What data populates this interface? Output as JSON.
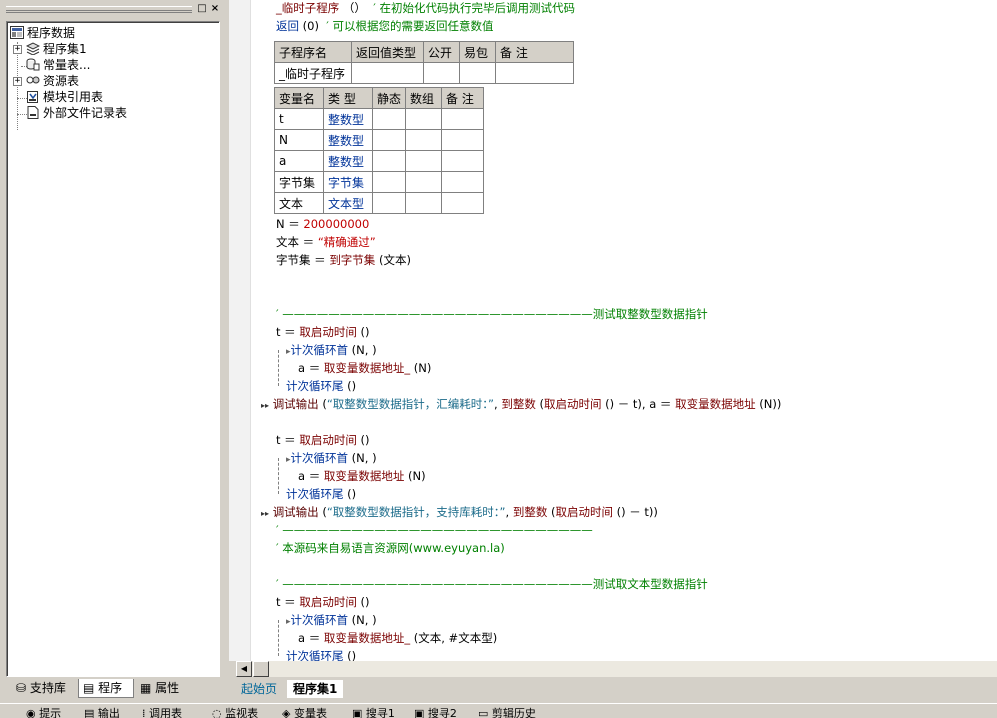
{
  "left_panel": {
    "close_glyph": "×",
    "restore_glyph": "□",
    "tree": [
      {
        "label": "程序数据",
        "icon": "program-data-icon"
      },
      {
        "label": "程序集1",
        "icon": "assembly-icon"
      },
      {
        "label": "常量表...",
        "icon": "constant-table-icon"
      },
      {
        "label": "资源表",
        "icon": "resource-table-icon"
      },
      {
        "label": "模块引用表",
        "icon": "module-ref-icon"
      },
      {
        "label": "外部文件记录表",
        "icon": "external-file-icon"
      }
    ],
    "tabs": [
      "支持库",
      "程序",
      "属性"
    ]
  },
  "code": {
    "sub_line": {
      "name": "_临时子程序",
      "parens": " （）",
      "comment": "′ 在初始化代码执行完毕后调用测试代码"
    },
    "return_line": {
      "kw": "返回",
      "arg": " (0)",
      "comment": "′ 可以根据您的需要返回任意数值"
    },
    "sub_table": {
      "headers": [
        "子程序名",
        "返回值类型",
        "公开",
        "易包",
        "备 注"
      ],
      "row": [
        "_临时子程序",
        "",
        "",
        "",
        ""
      ]
    },
    "var_table": {
      "headers": [
        "变量名",
        "类 型",
        "静态",
        "数组",
        "备 注"
      ],
      "rows": [
        [
          "t",
          "整数型",
          "",
          "",
          ""
        ],
        [
          "N",
          "整数型",
          "",
          "",
          ""
        ],
        [
          "a",
          "整数型",
          "",
          "",
          ""
        ],
        [
          "字节集",
          "字节集",
          "",
          "",
          ""
        ],
        [
          "文本",
          "文本型",
          "",
          "",
          ""
        ]
      ]
    },
    "assign1": {
      "lhs": "N ＝ ",
      "rhs": "200000000"
    },
    "assign2": {
      "lhs": "文本 ＝ ",
      "rhs": "“精确通过”"
    },
    "assign3": {
      "lhs": "字节集 ＝ ",
      "fn": "到字节集",
      "arg": " (文本)"
    },
    "sep1": "′ ———————————————————————————测试取整数型数据指针",
    "block1": {
      "t_assign": "t ＝ ",
      "t_fn": "取启动时间",
      "t_tail": " ()",
      "loop_head": "计次循环首",
      "loop_args": " (N, )",
      "body_lhs": "a ＝ ",
      "body_fn": "取变量数据地址_",
      "body_args": " (N)",
      "loop_tail": "计次循环尾",
      "loop_tail_args": " ()"
    },
    "debug1": {
      "fn": "调试输出",
      "p1": " (",
      "str": "“取整数型数据指针，汇编耗时：”",
      "p2": ", ",
      "fn2": "到整数",
      "p3": " (",
      "fn3": "取启动时间",
      "p4": " () － t), a ＝ ",
      "fn4": "取变量数据地址",
      "p5": " (N))"
    },
    "block2": {
      "t_assign": "t ＝ ",
      "t_fn": "取启动时间",
      "t_tail": " ()",
      "loop_head": "计次循环首",
      "loop_args": " (N, )",
      "body_lhs": "a ＝ ",
      "body_fn": "取变量数据地址",
      "body_args": " (N)",
      "loop_tail": "计次循环尾",
      "loop_tail_args": " ()"
    },
    "debug2": {
      "fn": "调试输出",
      "p1": " (",
      "str": "“取整数型数据指针，支持库耗时：”",
      "p2": ", ",
      "fn2": "到整数",
      "p3": " (",
      "fn3": "取启动时间",
      "p4": " () － t))"
    },
    "sep2": "′ ———————————————————————————",
    "source_comment": "′ 本源码来自易语言资源网(www.eyuyan.la)",
    "sep3": "′ ———————————————————————————测试取文本型数据指针",
    "block3": {
      "t_assign": "t ＝ ",
      "t_fn": "取启动时间",
      "t_tail": " ()",
      "loop_head": "计次循环首",
      "loop_args": " (N, )",
      "body_lhs": "a ＝ ",
      "body_fn": "取变量数据地址_",
      "body_args": " (文本, #文本型)",
      "loop_tail": "计次循环尾",
      "loop_tail_args": " ()"
    }
  },
  "doc_tabs": {
    "home": "起始页",
    "active": "程序集1"
  },
  "bottom_bar": [
    "提示",
    "输出",
    "调用表",
    "监视表",
    "变量表",
    "搜寻1",
    "搜寻2",
    "剪辑历史"
  ]
}
